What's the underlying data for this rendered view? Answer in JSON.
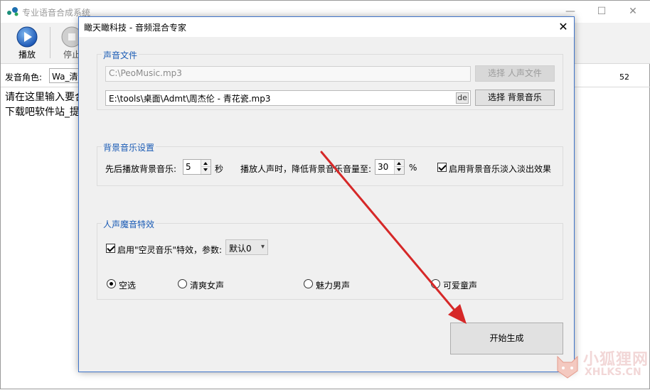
{
  "main_window": {
    "title": "专业语音合成系统",
    "minimize_glyph": "—",
    "maximize_glyph": "☐",
    "close_glyph": "✕"
  },
  "toolbar": {
    "play_label": "播放",
    "stop_label": "停止"
  },
  "voice_row": {
    "label": "发音角色:",
    "selected": "Wa_清新",
    "count": "52"
  },
  "text_area": {
    "line1": "请在这里输入要合",
    "line2": "下载吧软件站_提"
  },
  "dialog": {
    "title": "瞰天瞰科技 - 音频混合专家",
    "close_glyph": "✕",
    "sound_files": {
      "title": "声音文件",
      "voice_file_path": "C:\\PeoMusic.mp3",
      "voice_file_button": "选择 人声文件",
      "bg_music_path": "E:\\tools\\桌面\\Admt\\周杰伦 - 青花瓷.mp3",
      "de_button": "de",
      "bg_music_button": "选择 背景音乐"
    },
    "bg_settings": {
      "title": "背景音乐设置",
      "delay_label": "先后播放背景音乐:",
      "delay_value": "5",
      "delay_unit": "秒",
      "reduce_label": "播放人声时，降低背景音乐音量至:",
      "reduce_value": "30",
      "reduce_unit": "%",
      "fade_label": "启用背景音乐淡入淡出效果",
      "fade_checked": true
    },
    "effects": {
      "title": "人声魔音特效",
      "enable_label": "启用\"空灵音乐\"特效，参数:",
      "enable_checked": true,
      "param_value": "默认0",
      "radios": [
        {
          "label": "空选",
          "checked": true
        },
        {
          "label": "清爽女声",
          "checked": false
        },
        {
          "label": "魅力男声",
          "checked": false
        },
        {
          "label": "可爱童声",
          "checked": false
        }
      ]
    },
    "generate_button": "开始生成"
  },
  "watermark": {
    "text": "小狐狸网",
    "sub": "XHLKS.CN"
  },
  "colors": {
    "group_title": "#1a5bb5",
    "dialog_border": "#3f74c9",
    "annotation_arrow": "#d62828"
  },
  "icons": {
    "play": "play-circle-icon",
    "stop": "stop-circle-icon",
    "app": "app-logo-icon"
  }
}
